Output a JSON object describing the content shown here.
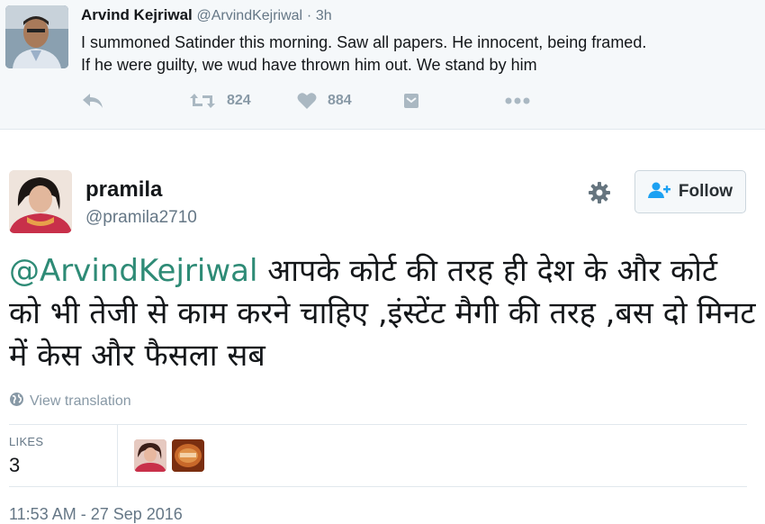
{
  "parent_tweet": {
    "name": "Arvind Kejriwal",
    "handle": "@ArvindKejriwal",
    "separator": "·",
    "time": "3h",
    "text_line1": "I summoned Satinder this morning. Saw all papers. He innocent, being framed.",
    "text_line2": "If he were guilty, we wud have thrown him out. We stand by him",
    "actions": {
      "reply_icon": "reply-icon",
      "retweet_icon": "retweet-icon",
      "retweet_count": "824",
      "like_icon": "heart-icon",
      "like_count": "884",
      "dm_icon": "message-icon",
      "more_icon": "more-icon"
    }
  },
  "tweet": {
    "fullname": "pramila",
    "screen_name": "@pramila2710",
    "mention": "@ArvindKejriwal",
    "text": " आपके कोर्ट की तरह ही देश के और कोर्ट को भी तेजी से काम करने चाहिए ,इंस्टेंट मैगी की तरह ,बस दो मिनट में केस और फैसला सब",
    "follow_label": "Follow",
    "settings_icon": "gear-icon",
    "translate_label": "View translation",
    "likes_label": "LIKES",
    "likes_count": "3",
    "timestamp": "11:53 AM - 27 Sep 2016"
  },
  "colors": {
    "mention": "#2e8b76",
    "muted": "#657786",
    "icon": "#aab8c2",
    "parent_bg": "#f5f8fa",
    "border": "#e1e8ed"
  }
}
